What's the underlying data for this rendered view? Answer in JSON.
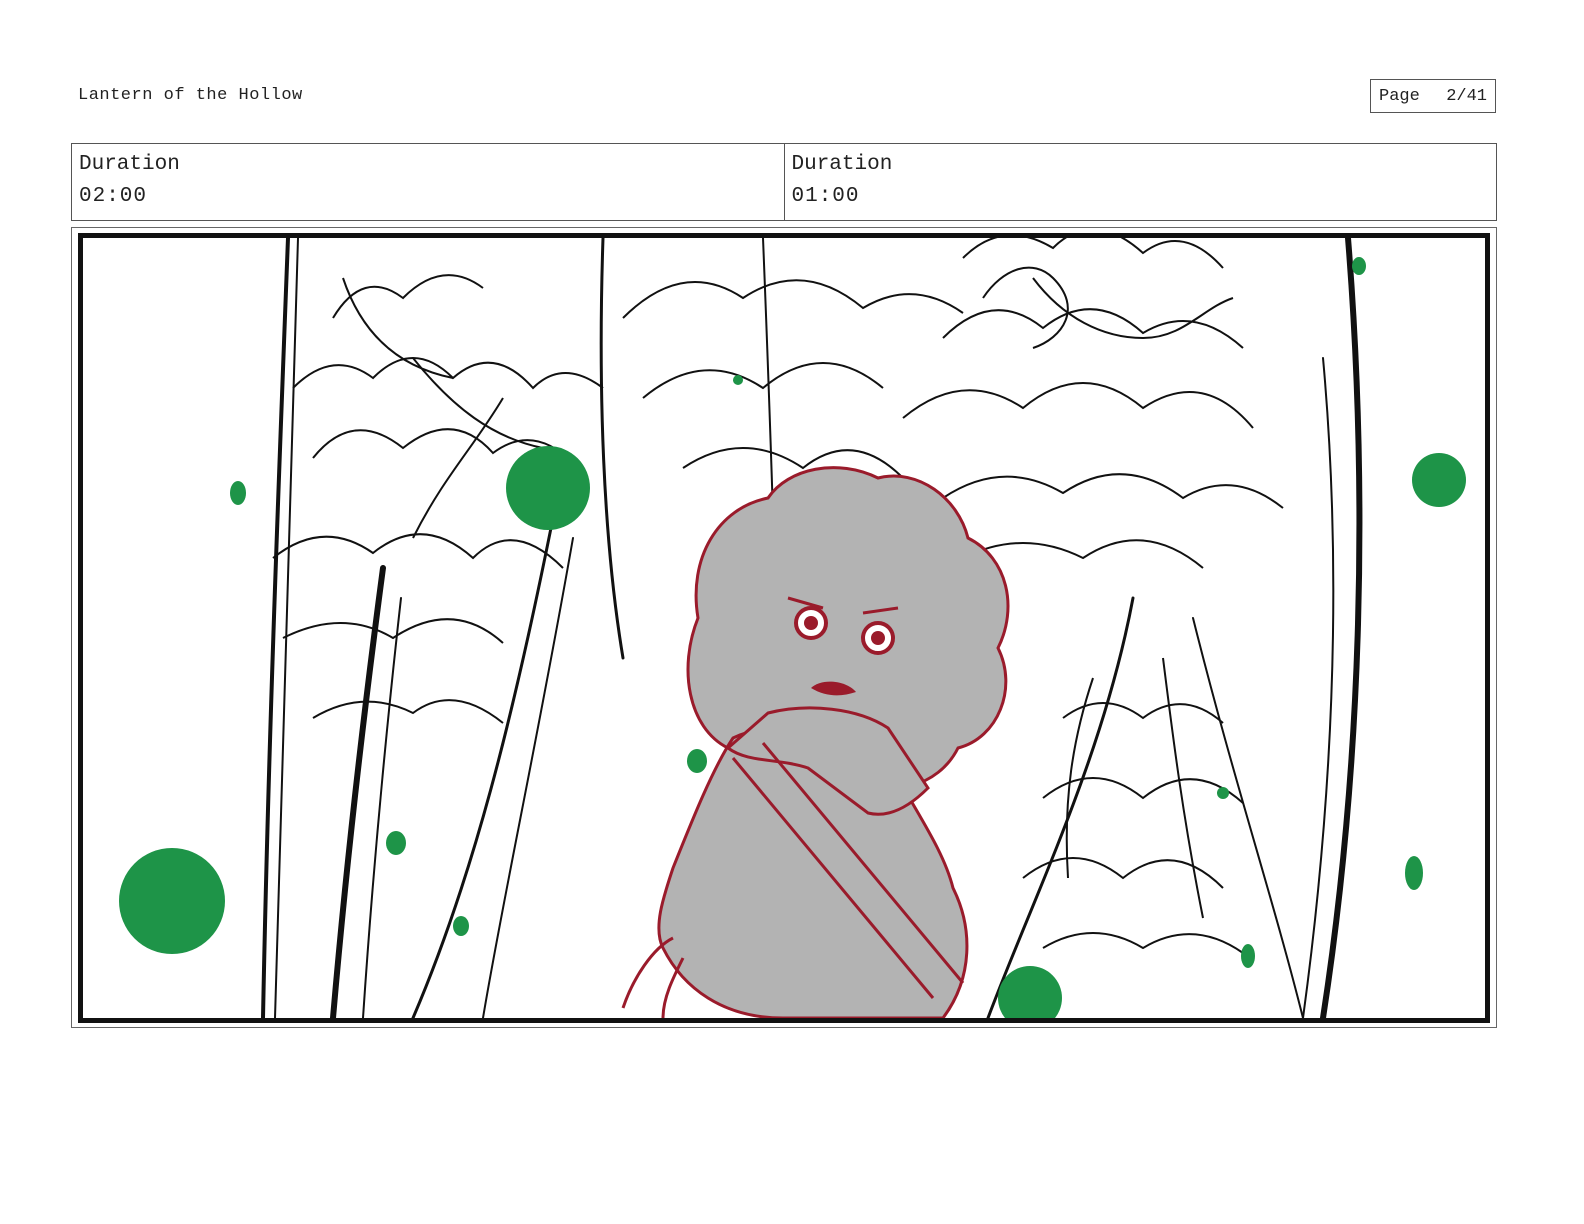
{
  "header": {
    "project_title": "Lantern of the Hollow",
    "page_label": "Page",
    "page_number": "2/41"
  },
  "durations": [
    {
      "label": "Duration",
      "value": "02:00"
    },
    {
      "label": "Duration",
      "value": "01:00"
    }
  ],
  "colors": {
    "sketch_line": "#111111",
    "character_line": "#9a1b2b",
    "character_fill": "#b3b3b3",
    "spore": "#1e9448"
  }
}
